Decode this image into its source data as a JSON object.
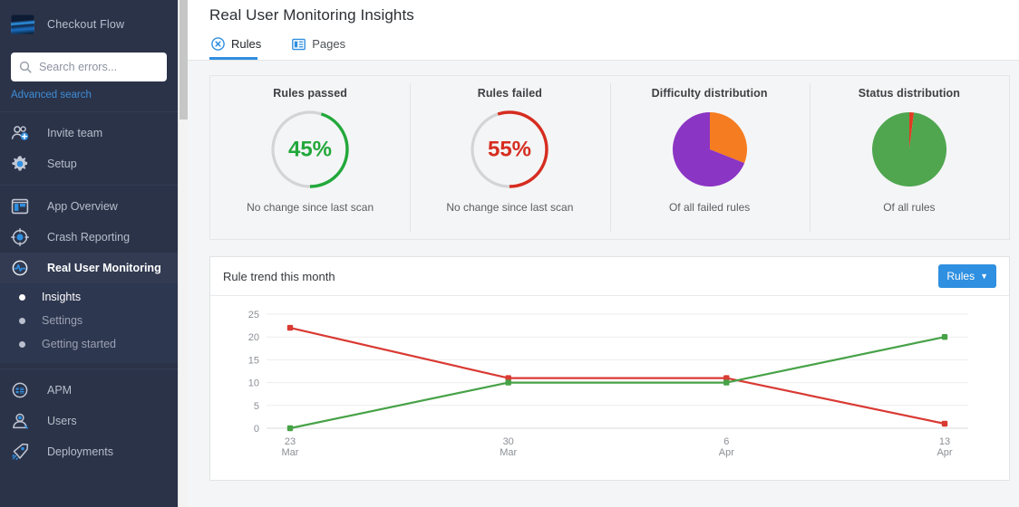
{
  "sidebar": {
    "brand": {
      "title": "Checkout Flow",
      "logo_icon": "app-logo-icon"
    },
    "search": {
      "placeholder": "Search errors...",
      "value": "",
      "icon": "search-icon"
    },
    "advanced_search_label": "Advanced search",
    "groups": [
      {
        "items": [
          {
            "label": "Invite team",
            "icon": "invite-team-icon"
          },
          {
            "label": "Setup",
            "icon": "gear-icon"
          }
        ]
      },
      {
        "items": [
          {
            "label": "App Overview",
            "icon": "app-overview-icon"
          },
          {
            "label": "Crash Reporting",
            "icon": "crash-reporting-icon"
          },
          {
            "label": "Real User Monitoring",
            "icon": "real-user-monitoring-icon",
            "current": true
          }
        ]
      }
    ],
    "sub_items": [
      {
        "label": "Insights",
        "current": true
      },
      {
        "label": "Settings",
        "current": false
      },
      {
        "label": "Getting started",
        "current": false
      }
    ],
    "bottom_items": [
      {
        "label": "APM",
        "icon": "apm-icon"
      },
      {
        "label": "Users",
        "icon": "users-icon"
      },
      {
        "label": "Deployments",
        "icon": "deployments-icon"
      }
    ]
  },
  "header": {
    "title": "Real User Monitoring Insights",
    "tabs": [
      {
        "label": "Rules",
        "icon": "rules-circle-x-icon",
        "active": true
      },
      {
        "label": "Pages",
        "icon": "pages-list-icon",
        "active": false
      }
    ]
  },
  "stats": [
    {
      "title": "Rules passed",
      "footer": "No change since last scan",
      "viz": "donut",
      "value_label": "45%",
      "percent": 45,
      "color": "#22a83a",
      "track_color": "#d2d4d6"
    },
    {
      "title": "Rules failed",
      "footer": "No change since last scan",
      "viz": "donut",
      "value_label": "55%",
      "percent": 55,
      "color": "#d62d20",
      "track_color": "#d2d4d6"
    },
    {
      "title": "Difficulty distribution",
      "footer": "Of all failed rules",
      "viz": "pie",
      "slices": [
        {
          "name": "orange-slice",
          "percent": 31,
          "color": "#f57c20"
        },
        {
          "name": "purple-slice",
          "percent": 69,
          "color": "#8b35c4"
        }
      ]
    },
    {
      "title": "Status distribution",
      "footer": "Of all rules",
      "viz": "pie",
      "slices": [
        {
          "name": "red-slice",
          "percent": 2,
          "color": "#e23b22"
        },
        {
          "name": "green-slice",
          "percent": 98,
          "color": "#4fa64f"
        }
      ]
    }
  ],
  "trend_panel": {
    "title": "Rule trend this month",
    "dropdown": {
      "label": "Rules",
      "caret": "▼"
    }
  },
  "chart_data": {
    "type": "line",
    "title": "Rule trend this month",
    "xlabel": "",
    "ylabel": "",
    "x": [
      "23\nMar",
      "30\nMar",
      "6\nApr",
      "13\nApr"
    ],
    "x_labels": [
      {
        "day": "23",
        "month": "Mar"
      },
      {
        "day": "30",
        "month": "Mar"
      },
      {
        "day": "6",
        "month": "Apr"
      },
      {
        "day": "13",
        "month": "Apr"
      }
    ],
    "yticks": [
      0,
      5,
      10,
      15,
      20,
      25
    ],
    "ylim": [
      0,
      25
    ],
    "grid": true,
    "legend": null,
    "series": [
      {
        "name": "Rules failed",
        "color": "#d93a33",
        "values": [
          22,
          11,
          11,
          1
        ]
      },
      {
        "name": "Rules passed",
        "color": "#47a247",
        "values": [
          0,
          10,
          10,
          20
        ]
      }
    ]
  }
}
